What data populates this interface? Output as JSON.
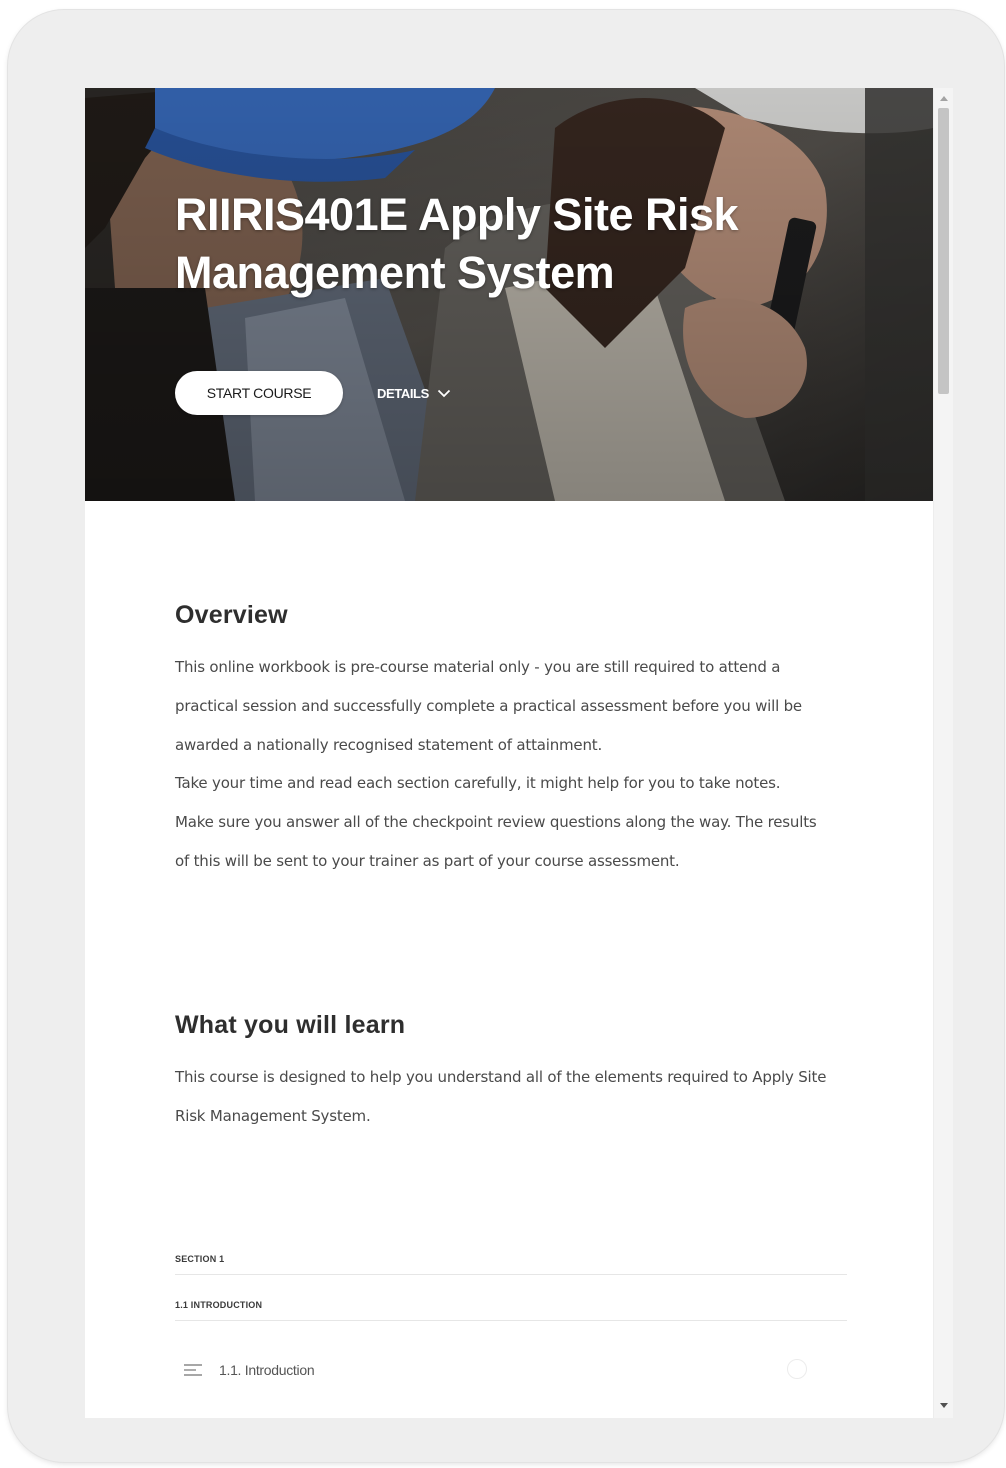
{
  "course": {
    "title": "RIIRIS401E Apply Site Risk Management System",
    "start_label": "START COURSE",
    "details_label": "DETAILS"
  },
  "overview": {
    "heading": "Overview",
    "paragraphs": [
      "This online workbook is pre-course material only - you are still required to attend a practical session and successfully complete a practical assessment before you will be awarded a nationally recognised statement of attainment.",
      "Take your time and read each section carefully, it might help for you to take notes.",
      "Make sure you answer all of the checkpoint review questions along the way. The results of this will be sent to your trainer as part of your course assessment."
    ]
  },
  "learn": {
    "heading": "What you will learn",
    "text": "This course is designed to help you understand all of the elements required to Apply Site Risk Management System."
  },
  "outline": {
    "section_label": "SECTION 1",
    "subsection_label": "1.1 INTRODUCTION",
    "lessons": [
      {
        "title": "1.1. Introduction",
        "icon": "text-lines-icon",
        "status": "incomplete"
      }
    ]
  },
  "colors": {
    "accent": "#ffffff",
    "heading": "#2e2e2e",
    "body_text": "#4a4a4a",
    "hardhat_blue": "#3a6fc4"
  }
}
